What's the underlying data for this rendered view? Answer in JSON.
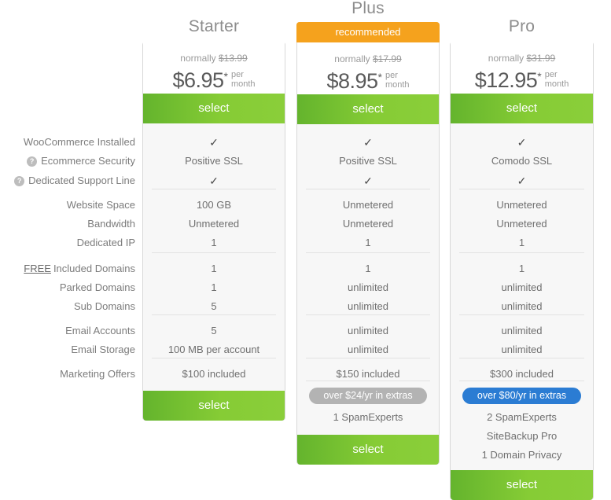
{
  "feature_labels": [
    {
      "text": "WooCommerce Installed",
      "help": false,
      "free": false
    },
    {
      "text": "Ecommerce Security",
      "help": true,
      "free": false
    },
    {
      "text": "Dedicated Support Line",
      "help": true,
      "free": false
    },
    {
      "text": "Website Space",
      "help": false,
      "free": false
    },
    {
      "text": "Bandwidth",
      "help": false,
      "free": false
    },
    {
      "text": "Dedicated IP",
      "help": false,
      "free": false
    },
    {
      "text": "Included Domains",
      "help": false,
      "free": true,
      "free_label": "FREE"
    },
    {
      "text": "Parked Domains",
      "help": false,
      "free": false
    },
    {
      "text": "Sub Domains",
      "help": false,
      "free": false
    },
    {
      "text": "Email Accounts",
      "help": false,
      "free": false
    },
    {
      "text": "Email Storage",
      "help": false,
      "free": false
    },
    {
      "text": "Marketing Offers",
      "help": false,
      "free": false
    }
  ],
  "help_icon_glyph": "?",
  "check_glyph": "✓",
  "colors": {
    "select_green": "#7ec92f",
    "recommended_orange": "#f5a21d",
    "extras_pill_gray": "#b3b3b3",
    "extras_pill_blue": "#2b7cd3",
    "card_bg": "#f7f7f7",
    "card_border": "#d8d8d8",
    "label_text": "#7c7c7c"
  },
  "plans": [
    {
      "name": "Starter",
      "recommended": false,
      "recommended_label": "",
      "normally_prefix": "normally",
      "normally_price": "$13.99",
      "price": "$6.95",
      "price_star": "*",
      "per": "per",
      "month": "month",
      "select_label": "select",
      "select_label_bottom": "select",
      "values": [
        "✓",
        "Positive SSL",
        "✓",
        "100 GB",
        "Unmetered",
        "1",
        "1",
        "1",
        "5",
        "5",
        "100 MB per account",
        "$100 included"
      ],
      "extras_pill": null,
      "extras_items": []
    },
    {
      "name": "Plus",
      "recommended": true,
      "recommended_label": "recommended",
      "normally_prefix": "normally",
      "normally_price": "$17.99",
      "price": "$8.95",
      "price_star": "*",
      "per": "per",
      "month": "month",
      "select_label": "select",
      "select_label_bottom": "select",
      "values": [
        "✓",
        "Positive SSL",
        "✓",
        "Unmetered",
        "Unmetered",
        "1",
        "1",
        "unlimited",
        "unlimited",
        "unlimited",
        "unlimited",
        "$150 included"
      ],
      "extras_pill": "over $24/yr in extras",
      "extras_items": [
        "1 SpamExperts"
      ]
    },
    {
      "name": "Pro",
      "recommended": false,
      "recommended_label": "",
      "normally_prefix": "normally",
      "normally_price": "$31.99",
      "price": "$12.95",
      "price_star": "*",
      "per": "per",
      "month": "month",
      "select_label": "select",
      "select_label_bottom": "select",
      "values": [
        "✓",
        "Comodo SSL",
        "✓",
        "Unmetered",
        "Unmetered",
        "1",
        "1",
        "unlimited",
        "unlimited",
        "unlimited",
        "unlimited",
        "$300 included"
      ],
      "extras_pill": "over $80/yr in extras",
      "extras_items": [
        "2 SpamExperts",
        "SiteBackup Pro",
        "1 Domain Privacy"
      ]
    }
  ]
}
